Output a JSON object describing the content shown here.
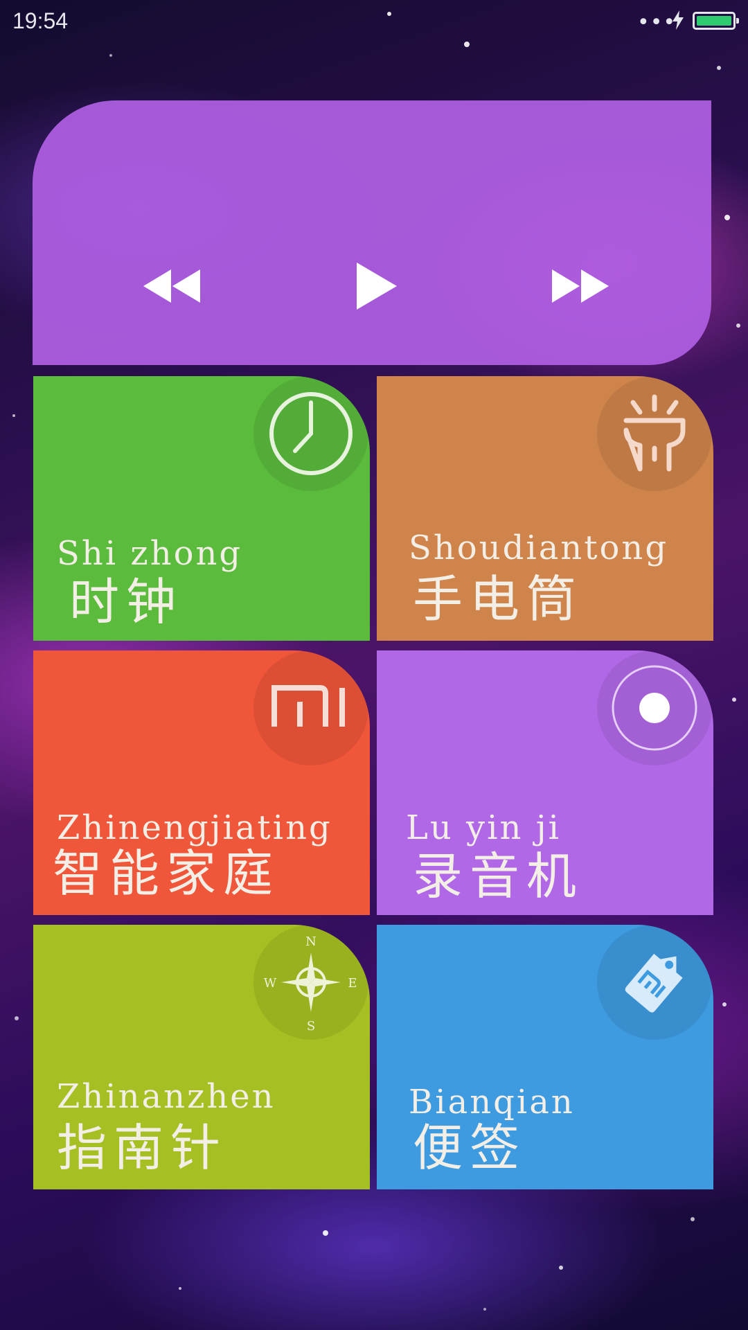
{
  "status_bar": {
    "time": "19:54",
    "signal_dots": "•••",
    "battery_color": "#2ecc71"
  },
  "player": {
    "background": "#b05fe4",
    "controls": [
      "rewind-icon",
      "play-icon",
      "fast-forward-icon"
    ]
  },
  "tiles": {
    "clock": {
      "pinyin": "Shi zhong",
      "name": "时钟",
      "color": "#5bbb3c",
      "icon": "clock-icon"
    },
    "torch": {
      "pinyin": "Shoudiantong",
      "name": "手电筒",
      "color": "#cf844b",
      "icon": "flashlight-icon"
    },
    "home": {
      "pinyin": "Zhinengjiating",
      "name": "智能家庭",
      "color": "#f0563a",
      "icon": "mi-logo-icon"
    },
    "rec": {
      "pinyin": "Lu yin ji",
      "name": "录音机",
      "color": "#b168e6",
      "icon": "record-icon"
    },
    "compass": {
      "pinyin": "Zhinanzhen",
      "name": "指南针",
      "color": "#a6bf22",
      "icon": "compass-icon",
      "directions": {
        "n": "N",
        "s": "S",
        "e": "E",
        "w": "W"
      }
    },
    "notes": {
      "pinyin": "Bianqian",
      "name": "便签",
      "color": "#3e9be0",
      "icon": "tag-icon"
    }
  }
}
